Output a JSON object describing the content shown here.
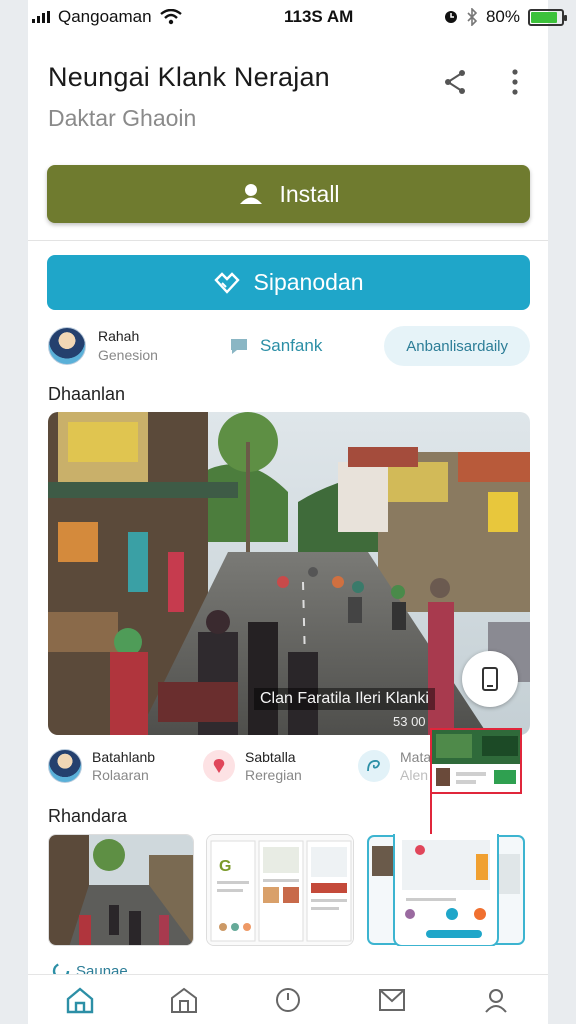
{
  "status_bar": {
    "carrier": "Qangoaman",
    "time": "113S AM",
    "battery_percent": "80%",
    "battery_level": 0.85
  },
  "app": {
    "title": "Neungai Klank Nerajan",
    "developer": "Daktar Ghaoin"
  },
  "buttons": {
    "install_label": "Install",
    "second_label": "Sipanodan",
    "install_color": "#6f7b2f",
    "second_color": "#1fa6c9"
  },
  "meta": {
    "publisher_name": "Rahah",
    "publisher_sub": "Genesion",
    "mid_label": "Sanfank",
    "pill_label": "Anbanlisardaily"
  },
  "sections": {
    "gallery_title": "Dhaanlan",
    "related_title": "Rhandara",
    "next_title": "Saunae"
  },
  "hero": {
    "caption": "Clan Faratila Ileri Klanki",
    "counter": "53 00"
  },
  "creators": [
    {
      "name": "Batahlanb",
      "sub": "Rolaaran"
    },
    {
      "name": "Sabtalla",
      "sub": "Reregian"
    },
    {
      "name": "Mata",
      "sub": "Alen"
    }
  ],
  "nav": [
    "home-icon",
    "store-icon",
    "clock-icon",
    "mail-icon",
    "profile-icon"
  ],
  "colors": {
    "accent_teal": "#1fa6c9",
    "highlight_red": "#e0263b"
  }
}
